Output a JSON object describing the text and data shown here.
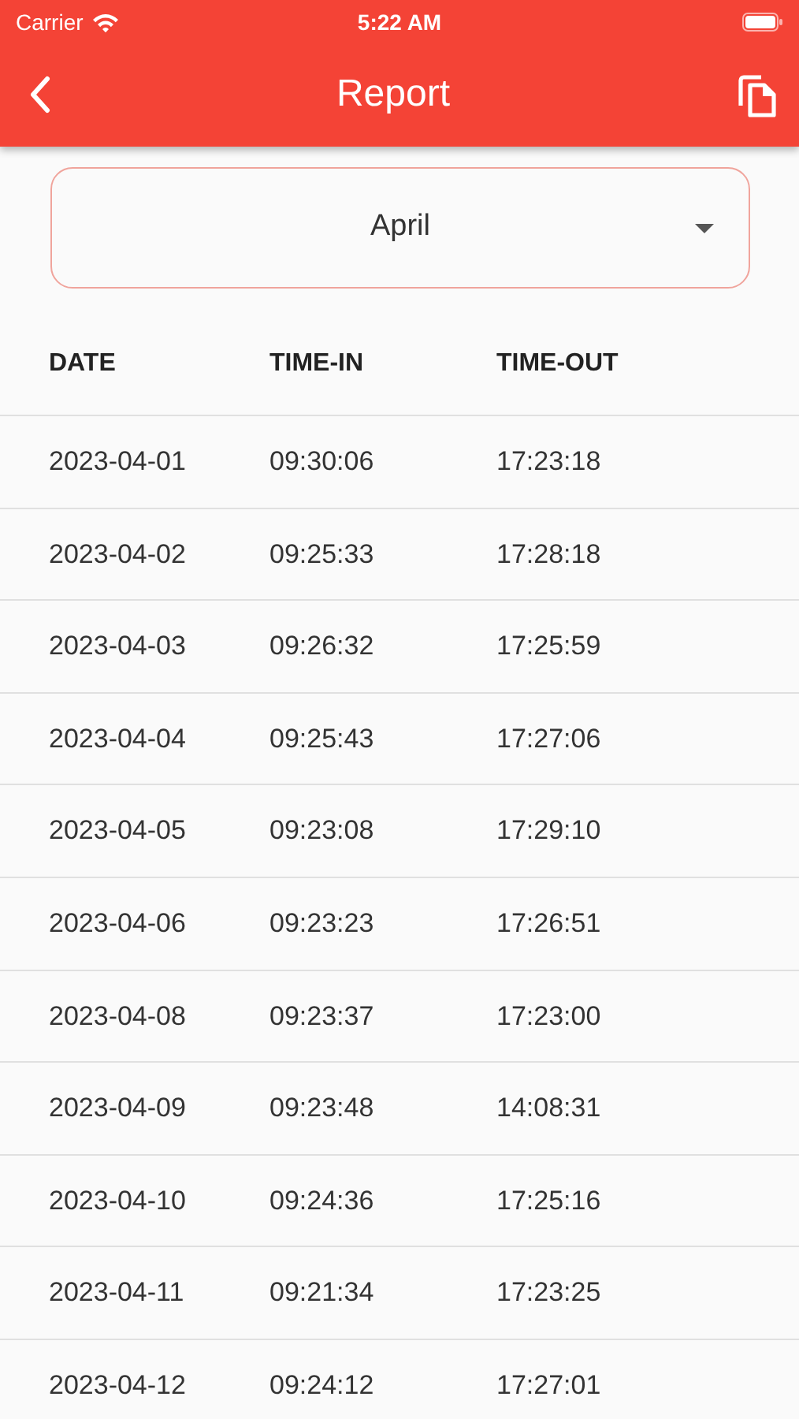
{
  "status_bar": {
    "carrier": "Carrier",
    "time": "5:22 AM"
  },
  "app_bar": {
    "title": "Report"
  },
  "month_select": {
    "value": "April"
  },
  "table": {
    "columns": [
      "DATE",
      "TIME-IN",
      "TIME-OUT"
    ],
    "rows": [
      [
        "2023-04-01",
        "09:30:06",
        "17:23:18"
      ],
      [
        "2023-04-02",
        "09:25:33",
        "17:28:18"
      ],
      [
        "2023-04-03",
        "09:26:32",
        "17:25:59"
      ],
      [
        "2023-04-04",
        "09:25:43",
        "17:27:06"
      ],
      [
        "2023-04-05",
        "09:23:08",
        "17:29:10"
      ],
      [
        "2023-04-06",
        "09:23:23",
        "17:26:51"
      ],
      [
        "2023-04-08",
        "09:23:37",
        "17:23:00"
      ],
      [
        "2023-04-09",
        "09:23:48",
        "14:08:31"
      ],
      [
        "2023-04-10",
        "09:24:36",
        "17:25:16"
      ],
      [
        "2023-04-11",
        "09:21:34",
        "17:23:25"
      ],
      [
        "2023-04-12",
        "09:24:12",
        "17:27:01"
      ]
    ]
  }
}
